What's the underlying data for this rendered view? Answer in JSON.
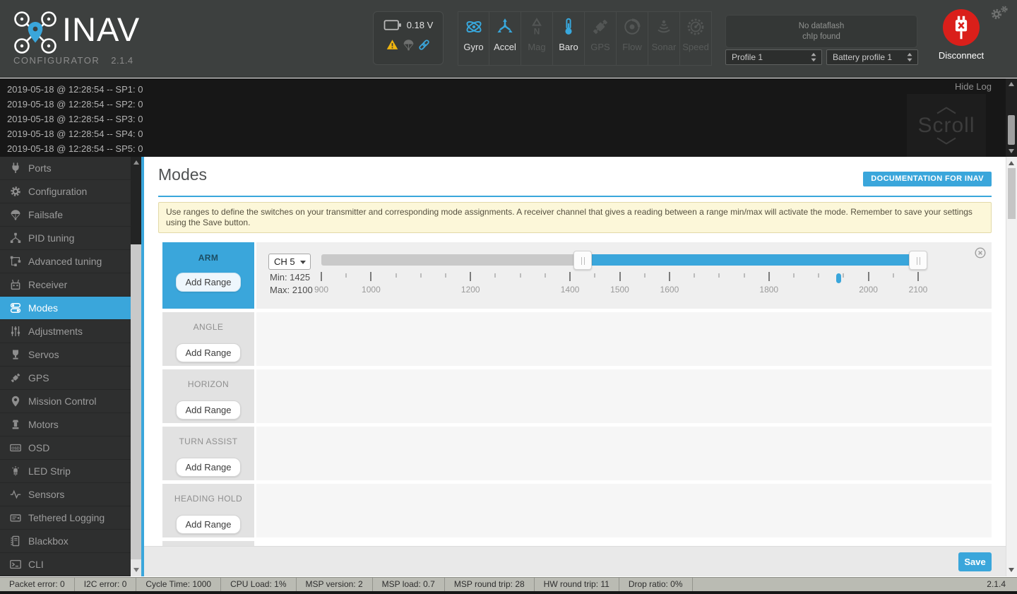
{
  "app": {
    "name": "INAV",
    "subtitle": "CONFIGURATOR",
    "version": "2.1.4",
    "logo_icon": "quadcopter-pin-icon"
  },
  "header": {
    "battery": {
      "voltage": "0.18 V",
      "icons": [
        "battery-icon",
        "warning-icon",
        "failsafe-icon",
        "link-icon"
      ]
    },
    "sensors": [
      {
        "label": "Gyro",
        "icon": "gyro-icon",
        "active": true
      },
      {
        "label": "Accel",
        "icon": "accel-icon",
        "active": true
      },
      {
        "label": "Mag",
        "icon": "mag-icon",
        "active": false
      },
      {
        "label": "Baro",
        "icon": "baro-icon",
        "active": true
      },
      {
        "label": "GPS",
        "icon": "gps-icon",
        "active": false
      },
      {
        "label": "Flow",
        "icon": "flow-icon",
        "active": false
      },
      {
        "label": "Sonar",
        "icon": "sonar-icon",
        "active": false
      },
      {
        "label": "Speed",
        "icon": "speed-icon",
        "active": false
      }
    ],
    "dataflash": {
      "line1": "No dataflash",
      "line2": "chIp found"
    },
    "profile_select": "Profile 1",
    "battery_profile_select": "Battery profile 1",
    "disconnect_label": "Disconnect",
    "settings_icon": "gears-icon"
  },
  "log": {
    "lines": [
      "2019-05-18 @ 12:28:54 -- SP1: 0",
      "2019-05-18 @ 12:28:54 -- SP2: 0",
      "2019-05-18 @ 12:28:54 -- SP3: 0",
      "2019-05-18 @ 12:28:54 -- SP4: 0",
      "2019-05-18 @ 12:28:54 -- SP5: 0"
    ],
    "hide_log_label": "Hide Log",
    "scroll_label": "Scroll"
  },
  "sidebar": {
    "items": [
      {
        "label": "Ports",
        "icon": "plug-icon",
        "active": false
      },
      {
        "label": "Configuration",
        "icon": "gear-icon",
        "active": false
      },
      {
        "label": "Failsafe",
        "icon": "parachute-icon",
        "active": false
      },
      {
        "label": "PID tuning",
        "icon": "pid-nodes-icon",
        "active": false
      },
      {
        "label": "Advanced tuning",
        "icon": "advanced-nodes-icon",
        "active": false
      },
      {
        "label": "Receiver",
        "icon": "transmitter-icon",
        "active": false
      },
      {
        "label": "Modes",
        "icon": "toggles-icon",
        "active": true
      },
      {
        "label": "Adjustments",
        "icon": "sliders-icon",
        "active": false
      },
      {
        "label": "Servos",
        "icon": "servo-icon",
        "active": false
      },
      {
        "label": "GPS",
        "icon": "satellite-icon",
        "active": false
      },
      {
        "label": "Mission Control",
        "icon": "map-pin-icon",
        "active": false
      },
      {
        "label": "Motors",
        "icon": "motor-icon",
        "active": false
      },
      {
        "label": "OSD",
        "icon": "osd-icon",
        "active": false
      },
      {
        "label": "LED Strip",
        "icon": "led-icon",
        "active": false
      },
      {
        "label": "Sensors",
        "icon": "waveform-icon",
        "active": false
      },
      {
        "label": "Tethered Logging",
        "icon": "logger-icon",
        "active": false
      },
      {
        "label": "Blackbox",
        "icon": "blackbox-icon",
        "active": false
      },
      {
        "label": "CLI",
        "icon": "terminal-icon",
        "active": false
      }
    ]
  },
  "main": {
    "title": "Modes",
    "doc_button_label": "DOCUMENTATION FOR INAV",
    "note": "Use ranges to define the switches on your transmitter and corresponding mode assignments. A receiver channel that gives a reading between a range min/max will activate the mode. Remember to save your settings using the Save button.",
    "save_label": "Save",
    "add_range_label": "Add Range",
    "scale": {
      "min": 900,
      "max": 2100,
      "minor_step": 50,
      "major_ticks": [
        900,
        1000,
        1200,
        1400,
        1500,
        1600,
        1800,
        2000,
        2100
      ]
    },
    "modes": [
      {
        "name": "ARM",
        "has_range": true,
        "range": {
          "channel": "CH 5",
          "min_label": "Min: 1425",
          "max_label": "Max: 2100",
          "min": 1425,
          "max": 2100,
          "current_value": 1940
        }
      },
      {
        "name": "ANGLE",
        "has_range": false
      },
      {
        "name": "HORIZON",
        "has_range": false
      },
      {
        "name": "TURN ASSIST",
        "has_range": false
      },
      {
        "name": "HEADING HOLD",
        "has_range": false
      }
    ]
  },
  "statusbar": {
    "items": [
      "Packet error: 0",
      "I2C error: 0",
      "Cycle Time: 1000",
      "CPU Load: 1%",
      "MSP version: 2",
      "MSP load: 0.7",
      "MSP round trip: 28",
      "HW round trip: 11",
      "Drop ratio: 0%"
    ],
    "version": "2.1.4"
  },
  "colors": {
    "accent": "#3aa6db",
    "danger": "#da1f1a",
    "warning": "#efb50f",
    "note_bg": "#fcf7d9"
  }
}
